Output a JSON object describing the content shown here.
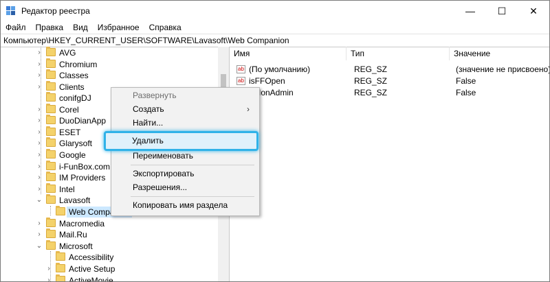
{
  "window": {
    "title": "Редактор реестра",
    "controls": {
      "minimize": "—",
      "maximize": "☐",
      "close": "✕"
    }
  },
  "menu": [
    "Файл",
    "Правка",
    "Вид",
    "Избранное",
    "Справка"
  ],
  "address": "Компьютер\\HKEY_CURRENT_USER\\SOFTWARE\\Lavasoft\\Web Companion",
  "tree": {
    "items": [
      {
        "label": "AVG",
        "expander": "›"
      },
      {
        "label": "Chromium",
        "expander": "›"
      },
      {
        "label": "Classes",
        "expander": "›"
      },
      {
        "label": "Clients",
        "expander": "›"
      },
      {
        "label": "conifgDJ",
        "expander": ""
      },
      {
        "label": "Corel",
        "expander": "›"
      },
      {
        "label": "DuoDianApp",
        "expander": "›"
      },
      {
        "label": "ESET",
        "expander": "›"
      },
      {
        "label": "Glarysoft",
        "expander": "›"
      },
      {
        "label": "Google",
        "expander": "›"
      },
      {
        "label": "i-FunBox.com",
        "expander": "›"
      },
      {
        "label": "IM Providers",
        "expander": "›"
      },
      {
        "label": "Intel",
        "expander": "›"
      },
      {
        "label": "Lavasoft",
        "expander": "⌄"
      },
      {
        "label": "Web Companion",
        "expander": ""
      },
      {
        "label": "Macromedia",
        "expander": "›"
      },
      {
        "label": "Mail.Ru",
        "expander": "›"
      },
      {
        "label": "Microsoft",
        "expander": "⌄"
      },
      {
        "label": "Accessibility",
        "expander": ""
      },
      {
        "label": "Active Setup",
        "expander": "›"
      },
      {
        "label": "ActiveMovie",
        "expander": "›"
      }
    ]
  },
  "values": {
    "columns": [
      "Имя",
      "Тип",
      "Значение"
    ],
    "rows": [
      {
        "name": "(По умолчанию)",
        "type": "REG_SZ",
        "data": "(значение не присвоено)"
      },
      {
        "name": "isFFOpen",
        "type": "REG_SZ",
        "data": "False"
      },
      {
        "name": "isNonAdmin",
        "type": "REG_SZ",
        "data": "False"
      }
    ]
  },
  "context_menu": {
    "expand": "Развернуть",
    "create": "Создать",
    "create_arrow": "›",
    "find": "Найти...",
    "delete": "Удалить",
    "rename": "Переименовать",
    "export": "Экспортировать",
    "permissions": "Разрешения...",
    "copy_key": "Копировать имя раздела"
  },
  "colors": {
    "highlight_border": "#2fb2e8",
    "folder": "#f4d26b"
  }
}
